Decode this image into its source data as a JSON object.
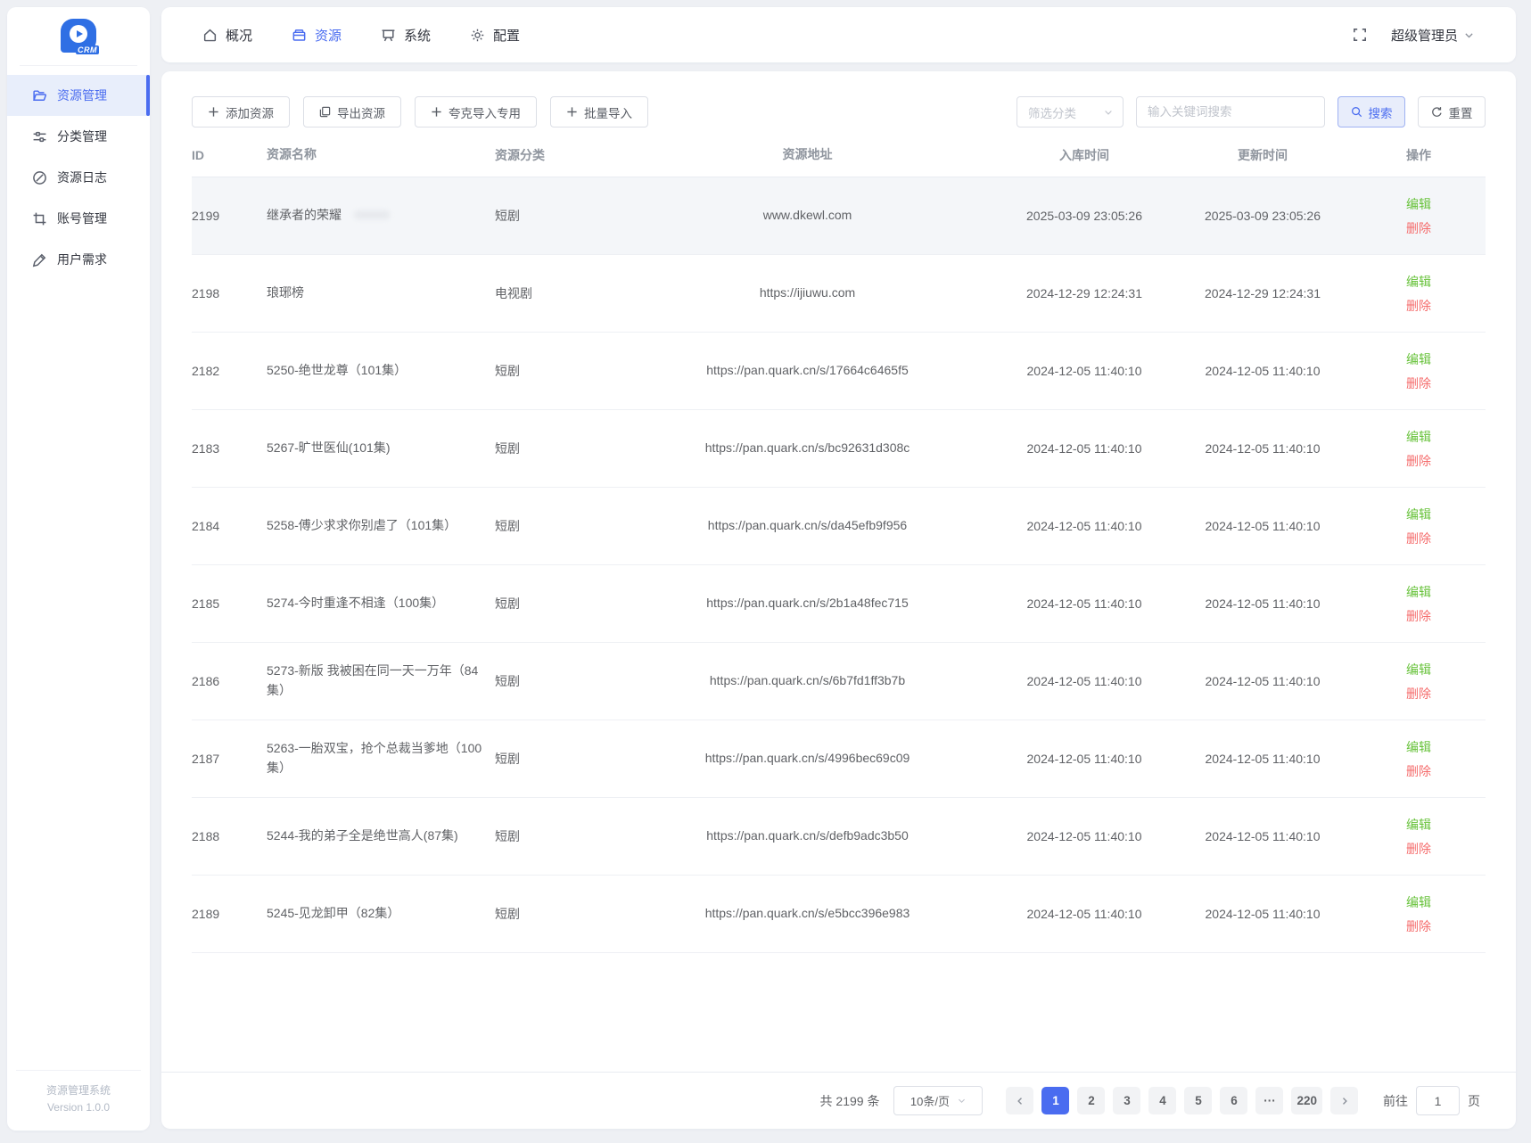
{
  "colors": {
    "primary": "#4a6cf0",
    "success": "#67c23a",
    "danger": "#f56c6c"
  },
  "app": {
    "logo_text": "CRM",
    "footer_line1": "资源管理系统",
    "footer_line2": "Version 1.0.0"
  },
  "topnav": {
    "items": [
      {
        "label": "概况",
        "icon": "home",
        "active": false
      },
      {
        "label": "资源",
        "icon": "resource",
        "active": true
      },
      {
        "label": "系统",
        "icon": "monitor",
        "active": false
      },
      {
        "label": "配置",
        "icon": "gear",
        "active": false
      }
    ],
    "user": "超级管理员"
  },
  "sidebar": {
    "items": [
      {
        "label": "资源管理",
        "icon": "folder",
        "active": true
      },
      {
        "label": "分类管理",
        "icon": "sliders",
        "active": false
      },
      {
        "label": "资源日志",
        "icon": "compass",
        "active": false
      },
      {
        "label": "账号管理",
        "icon": "crop",
        "active": false
      },
      {
        "label": "用户需求",
        "icon": "pen",
        "active": false
      }
    ]
  },
  "toolbar": {
    "buttons": [
      {
        "label": "添加资源",
        "icon": "plus"
      },
      {
        "label": "导出资源",
        "icon": "export"
      },
      {
        "label": "夸克导入专用",
        "icon": "plus"
      },
      {
        "label": "批量导入",
        "icon": "plus"
      }
    ],
    "filter_placeholder": "筛选分类",
    "search_placeholder": "输入关键词搜索",
    "search_label": "搜索",
    "reset_label": "重置"
  },
  "table": {
    "columns": [
      "ID",
      "资源名称",
      "资源分类",
      "资源地址",
      "入库时间",
      "更新时间",
      "操作"
    ],
    "edit_label": "编辑",
    "delete_label": "删除",
    "rows": [
      {
        "id": "2199",
        "name": "继承者的荣耀",
        "redacted": true,
        "highlighted": true,
        "category": "短剧",
        "url": "www.dkewl.com",
        "created": "2025-03-09 23:05:26",
        "updated": "2025-03-09 23:05:26"
      },
      {
        "id": "2198",
        "name": "琅琊榜",
        "category": "电视剧",
        "url": "https://ijiuwu.com",
        "created": "2024-12-29 12:24:31",
        "updated": "2024-12-29 12:24:31"
      },
      {
        "id": "2182",
        "name": "5250-绝世龙尊（101集）",
        "category": "短剧",
        "url": "https://pan.quark.cn/s/17664c6465f5",
        "created": "2024-12-05 11:40:10",
        "updated": "2024-12-05 11:40:10"
      },
      {
        "id": "2183",
        "name": "5267-旷世医仙(101集)",
        "category": "短剧",
        "url": "https://pan.quark.cn/s/bc92631d308c",
        "created": "2024-12-05 11:40:10",
        "updated": "2024-12-05 11:40:10"
      },
      {
        "id": "2184",
        "name": "5258-傅少求求你别虐了（101集）",
        "category": "短剧",
        "url": "https://pan.quark.cn/s/da45efb9f956",
        "created": "2024-12-05 11:40:10",
        "updated": "2024-12-05 11:40:10"
      },
      {
        "id": "2185",
        "name": "5274-今时重逢不相逢（100集）",
        "category": "短剧",
        "url": "https://pan.quark.cn/s/2b1a48fec715",
        "created": "2024-12-05 11:40:10",
        "updated": "2024-12-05 11:40:10"
      },
      {
        "id": "2186",
        "name": "5273-新版 我被困在同一天一万年（84集）",
        "category": "短剧",
        "url": "https://pan.quark.cn/s/6b7fd1ff3b7b",
        "created": "2024-12-05 11:40:10",
        "updated": "2024-12-05 11:40:10"
      },
      {
        "id": "2187",
        "name": "5263-一胎双宝，抢个总裁当爹地（100集）",
        "category": "短剧",
        "url": "https://pan.quark.cn/s/4996bec69c09",
        "created": "2024-12-05 11:40:10",
        "updated": "2024-12-05 11:40:10"
      },
      {
        "id": "2188",
        "name": "5244-我的弟子全是绝世高人(87集)",
        "category": "短剧",
        "url": "https://pan.quark.cn/s/defb9adc3b50",
        "created": "2024-12-05 11:40:10",
        "updated": "2024-12-05 11:40:10"
      },
      {
        "id": "2189",
        "name": "5245-见龙卸甲（82集）",
        "category": "短剧",
        "url": "https://pan.quark.cn/s/e5bcc396e983",
        "created": "2024-12-05 11:40:10",
        "updated": "2024-12-05 11:40:10"
      }
    ]
  },
  "pagination": {
    "total_text": "共 2199 条",
    "page_size": "10条/页",
    "pages": [
      {
        "label": "1",
        "active": true
      },
      {
        "label": "2",
        "active": false
      },
      {
        "label": "3",
        "active": false
      },
      {
        "label": "4",
        "active": false
      },
      {
        "label": "5",
        "active": false
      },
      {
        "label": "6",
        "active": false
      },
      {
        "label": "···",
        "active": false
      },
      {
        "label": "220",
        "active": false
      }
    ],
    "goto_label": "前往",
    "goto_value": "1",
    "goto_suffix": "页"
  }
}
